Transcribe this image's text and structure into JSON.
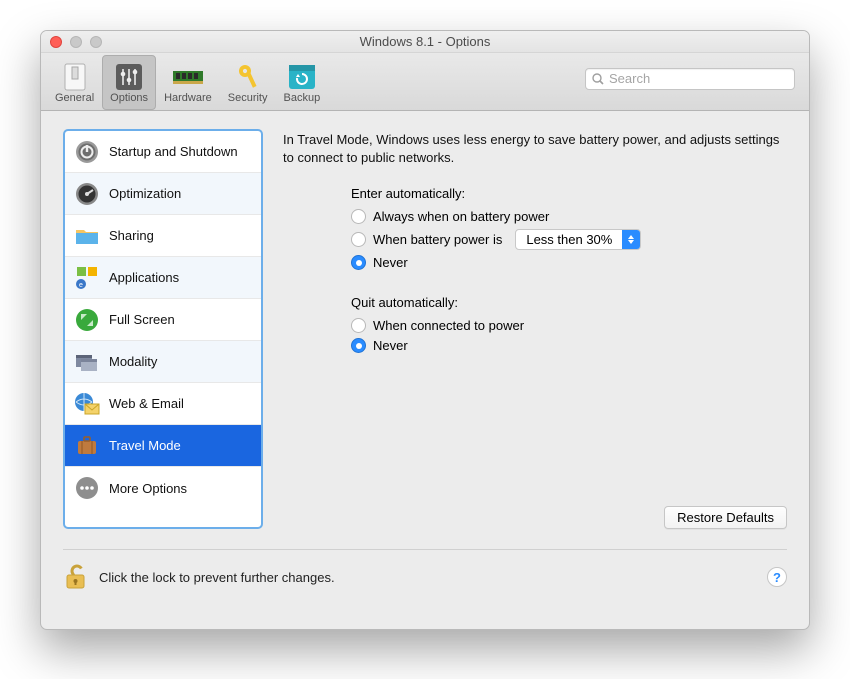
{
  "window": {
    "title": "Windows 8.1 - Options"
  },
  "toolbar": {
    "items": [
      {
        "label": "General"
      },
      {
        "label": "Options"
      },
      {
        "label": "Hardware"
      },
      {
        "label": "Security"
      },
      {
        "label": "Backup"
      }
    ],
    "selected": "Options"
  },
  "search": {
    "placeholder": "Search"
  },
  "sidebar": {
    "items": [
      {
        "label": "Startup and Shutdown"
      },
      {
        "label": "Optimization"
      },
      {
        "label": "Sharing"
      },
      {
        "label": "Applications"
      },
      {
        "label": "Full Screen"
      },
      {
        "label": "Modality"
      },
      {
        "label": "Web & Email"
      },
      {
        "label": "Travel Mode"
      },
      {
        "label": "More Options"
      }
    ],
    "selected": "Travel Mode"
  },
  "panel": {
    "description": "In Travel Mode, Windows uses less energy to save battery power, and adjusts settings to connect to public networks.",
    "enter": {
      "title": "Enter automatically:",
      "opt_always": "Always when on battery power",
      "opt_when": "When battery power is",
      "threshold": "Less then 30%",
      "opt_never": "Never",
      "selected": "never"
    },
    "quit": {
      "title": "Quit automatically:",
      "opt_connected": "When connected to power",
      "opt_never": "Never",
      "selected": "never"
    },
    "restore_label": "Restore Defaults"
  },
  "footer": {
    "lock_text": "Click the lock to prevent further changes."
  }
}
